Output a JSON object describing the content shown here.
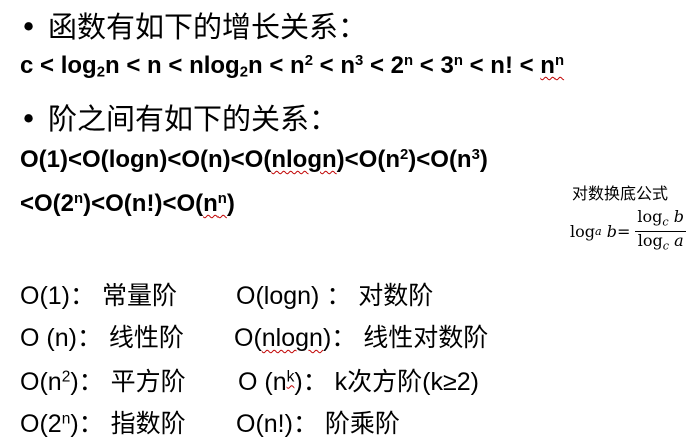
{
  "bullet_symbol": "•",
  "growth": {
    "heading": "函数有如下的增长关系：",
    "c": "c",
    "lt": " < ",
    "log": "log",
    "base": "2",
    "n": "n",
    "nlog": "nlog",
    "sq": "2",
    "cube": "3",
    "two": "2",
    "three": "3",
    "exp_n": "n",
    "fact": "n!"
  },
  "order": {
    "heading": "阶之间有如下的关系：",
    "line1_a": "O(1)<O(",
    "logn": "logn",
    "line1_b": ")<O(n)<O(",
    "nlogn": "nlogn",
    "line1_c": ")<O(n",
    "sq": "2",
    "line1_d": ")<O(n",
    "cube": "3",
    "line1_e": ")",
    "line2_a": "<O(2",
    "exp_n": "n",
    "line2_b": ")<O(n!)<O(",
    "nn_base": "n",
    "nn_exp": "n",
    "line2_c": ")"
  },
  "formula": {
    "title": "对数换底公式",
    "log": "log",
    "a": "a",
    "b": "b",
    "c": "c",
    "eq": " = "
  },
  "complexities": {
    "r1c1": "O(1)：  常量阶",
    "r1c2_a": "O(",
    "r1c2_logn": "logn",
    "r1c2_b": ") ：  对数阶",
    "r2c1": "O (n)：  线性阶",
    "r2c2_a": "O(",
    "r2c2_nlogn": "nlogn",
    "r2c2_b": ")：  线性对数阶",
    "r3c1_a": "O(n",
    "r3c1_sup": "2",
    "r3c1_b": ")：  平方阶",
    "r3c2_a": "O (n",
    "r3c2_sup": "k",
    "r3c2_b": ")：  k次方阶(k≥2)",
    "r4c1_a": "O(2",
    "r4c1_sup": "n",
    "r4c1_b": ")：  指数阶",
    "r4c2": "O(n!)：  阶乘阶"
  }
}
